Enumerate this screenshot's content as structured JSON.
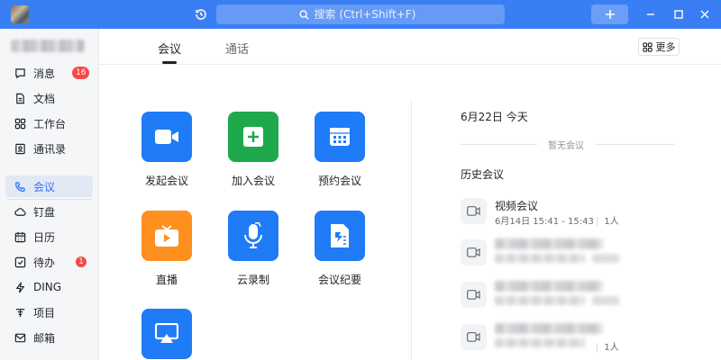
{
  "titlebar": {
    "search_placeholder": "搜索 (Ctrl+Shift+F)",
    "accent": "#3a7ef4"
  },
  "sidebar": {
    "items": [
      {
        "label": "消息",
        "icon": "chat-icon",
        "badge": "16"
      },
      {
        "label": "文档",
        "icon": "document-icon"
      },
      {
        "label": "工作台",
        "icon": "grid-icon"
      },
      {
        "label": "通讯录",
        "icon": "contacts-icon"
      },
      {
        "label": "会议",
        "icon": "phone-icon",
        "active": true
      },
      {
        "label": "钉盘",
        "icon": "cloud-icon"
      },
      {
        "label": "日历",
        "icon": "calendar-icon"
      },
      {
        "label": "待办",
        "icon": "todo-icon",
        "badge": "1"
      },
      {
        "label": "DING",
        "icon": "lightning-icon"
      },
      {
        "label": "项目",
        "icon": "project-icon"
      },
      {
        "label": "邮箱",
        "icon": "mail-icon"
      }
    ]
  },
  "tabs": [
    {
      "label": "会议"
    },
    {
      "label": "通话"
    }
  ],
  "more_label": "更多",
  "tiles": [
    {
      "label": "发起会议",
      "icon": "video-camera-icon",
      "color": "#1f7bf6"
    },
    {
      "label": "加入会议",
      "icon": "plus-square-icon",
      "color": "#1eaa4c"
    },
    {
      "label": "预约会议",
      "icon": "calendar-icon",
      "color": "#1f7bf6"
    },
    {
      "label": "直播",
      "icon": "tv-icon",
      "color": "#ff8f1f"
    },
    {
      "label": "云录制",
      "icon": "microphone-icon",
      "color": "#1f7bf6"
    },
    {
      "label": "会议纪要",
      "icon": "notes-icon",
      "color": "#1f7bf6"
    },
    {
      "label": "",
      "icon": "screen-cast-icon",
      "color": "#1f7bf6"
    }
  ],
  "today": {
    "date_label": "6月22日 今天",
    "empty_label": "暂无会议"
  },
  "history": {
    "title": "历史会议",
    "items": [
      {
        "title": "视频会议",
        "time": "6月14日 15:41 - 15:43",
        "count": "1人"
      },
      {
        "count": ""
      },
      {
        "count": ""
      },
      {
        "count": "1人"
      }
    ]
  }
}
